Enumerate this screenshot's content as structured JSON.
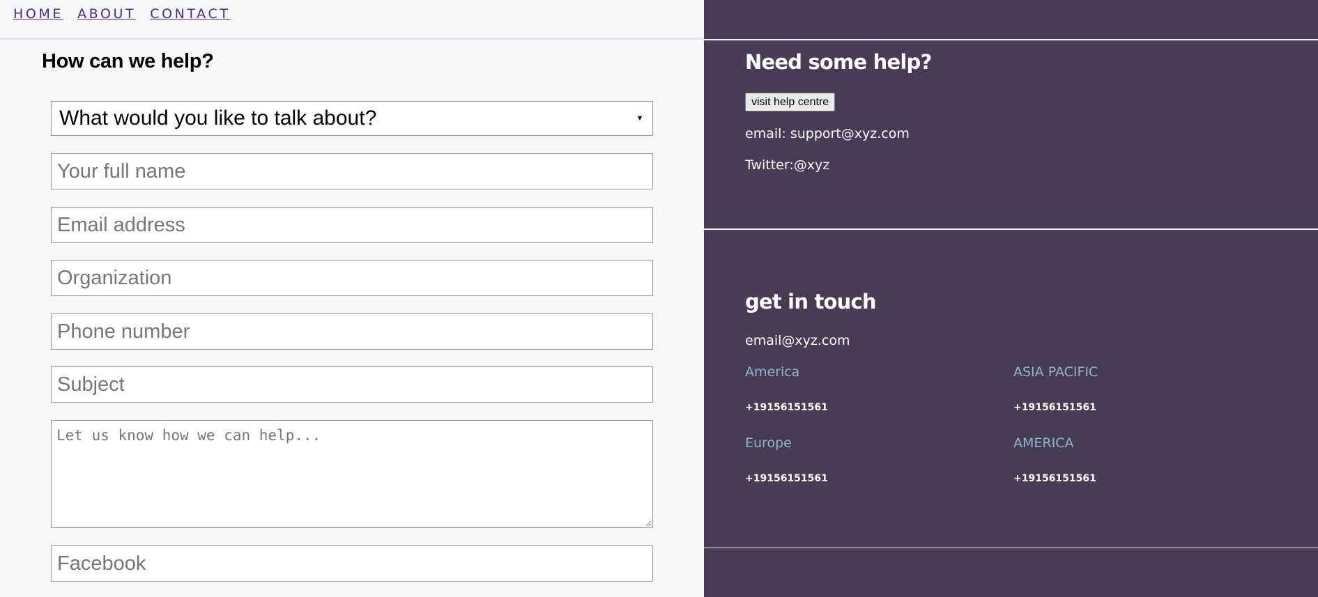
{
  "nav": {
    "items": [
      "HOME",
      "ABOUT",
      "CONTACT"
    ]
  },
  "form": {
    "title": "How can we help?",
    "topic_select": "What would you like to talk about?",
    "full_name_placeholder": "Your full name",
    "email_placeholder": "Email address",
    "organization_placeholder": "Organization",
    "phone_placeholder": "Phone number",
    "subject_placeholder": "Subject",
    "message_placeholder": "Let us know how we can help...",
    "facebook_placeholder": "Facebook"
  },
  "help": {
    "title": "Need some help?",
    "button_label": "visit help centre",
    "email": "email: support@xyz.com",
    "twitter": "Twitter:@xyz"
  },
  "touch": {
    "title": "get in touch",
    "email": "email@xyz.com",
    "offices": [
      {
        "region": "America",
        "phone": "+19156151561"
      },
      {
        "region": "ASIA PACIFIC",
        "phone": "+19156151561"
      },
      {
        "region": "Europe",
        "phone": "+19156151561"
      },
      {
        "region": "AMERICA",
        "phone": "+19156151561"
      }
    ]
  },
  "colors": {
    "panel_bg": "#473b56",
    "page_bg": "#f6f7f9",
    "nav_link": "#4b2b7a",
    "region_label": "#8fb5cf"
  }
}
